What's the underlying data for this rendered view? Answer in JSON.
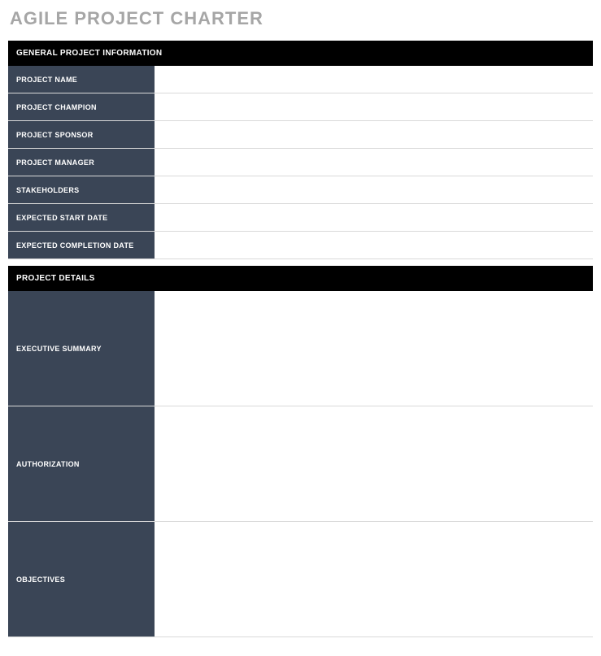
{
  "page_title": "AGILE PROJECT CHARTER",
  "sections": {
    "general": {
      "header": "GENERAL PROJECT INFORMATION",
      "rows": {
        "project_name": {
          "label": "PROJECT NAME",
          "value": ""
        },
        "project_champion": {
          "label": "PROJECT CHAMPION",
          "value": ""
        },
        "project_sponsor": {
          "label": "PROJECT SPONSOR",
          "value": ""
        },
        "project_manager": {
          "label": "PROJECT MANAGER",
          "value": ""
        },
        "stakeholders": {
          "label": "STAKEHOLDERS",
          "value": ""
        },
        "expected_start": {
          "label": "EXPECTED START DATE",
          "value": ""
        },
        "expected_completion": {
          "label": "EXPECTED COMPLETION DATE",
          "value": ""
        }
      }
    },
    "details": {
      "header": "PROJECT DETAILS",
      "rows": {
        "executive_summary": {
          "label": "EXECUTIVE SUMMARY",
          "value": ""
        },
        "authorization": {
          "label": "AUTHORIZATION",
          "value": ""
        },
        "objectives": {
          "label": "OBJECTIVES",
          "value": ""
        }
      }
    }
  }
}
